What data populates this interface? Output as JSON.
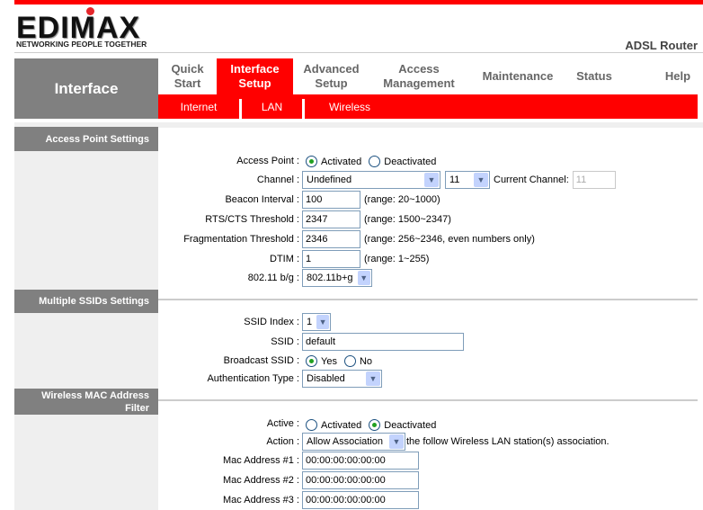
{
  "brand": {
    "logo_text": "EDIMAX",
    "tagline": "NETWORKING PEOPLE TOGETHER",
    "product": "ADSL Router",
    "accent": "#ff0000"
  },
  "nav": {
    "section": "Interface",
    "tabs": [
      {
        "label1": "Quick",
        "label2": "Start"
      },
      {
        "label1": "Interface",
        "label2": "Setup",
        "active": true
      },
      {
        "label1": "Advanced",
        "label2": "Setup"
      },
      {
        "label1": "Access",
        "label2": "Management"
      },
      {
        "label1": "Maintenance"
      },
      {
        "label1": "Status"
      },
      {
        "label1": "Help"
      }
    ],
    "subtabs": [
      "Internet",
      "LAN",
      "Wireless"
    ]
  },
  "ap": {
    "header": "Access Point Settings",
    "access_point_label": "Access Point :",
    "activated": "Activated",
    "deactivated": "Deactivated",
    "channel_label": "Channel :",
    "channel_region": "Undefined",
    "channel": "11",
    "current_channel_label": "Current Channel:",
    "current_channel": "11",
    "beacon_label": "Beacon Interval :",
    "beacon": "100",
    "beacon_range": "(range: 20~1000)",
    "rts_label": "RTS/CTS Threshold :",
    "rts": "2347",
    "rts_range": "(range: 1500~2347)",
    "frag_label": "Fragmentation Threshold :",
    "frag": "2346",
    "frag_range": "(range: 256~2346, even numbers only)",
    "dtim_label": "DTIM :",
    "dtim": "1",
    "dtim_range": "(range: 1~255)",
    "mode_label": "802.11 b/g :",
    "mode": "802.11b+g"
  },
  "ssid": {
    "header": "Multiple SSIDs Settings",
    "index_label": "SSID Index :",
    "index": "1",
    "ssid_label": "SSID :",
    "ssid": "default",
    "broadcast_label": "Broadcast SSID :",
    "yes": "Yes",
    "no": "No",
    "auth_label": "Authentication Type :",
    "auth": "Disabled"
  },
  "mac": {
    "header1": "Wireless MAC Address",
    "header2": "Filter",
    "active_label": "Active :",
    "activated": "Activated",
    "deactivated": "Deactivated",
    "action_label": "Action :",
    "action": "Allow Association",
    "action_suffix": "the follow Wireless LAN station(s) association.",
    "addresses": [
      {
        "label": "Mac Address #1 :",
        "value": "00:00:00:00:00:00"
      },
      {
        "label": "Mac Address #2 :",
        "value": "00:00:00:00:00:00"
      },
      {
        "label": "Mac Address #3 :",
        "value": "00:00:00:00:00:00"
      }
    ]
  }
}
